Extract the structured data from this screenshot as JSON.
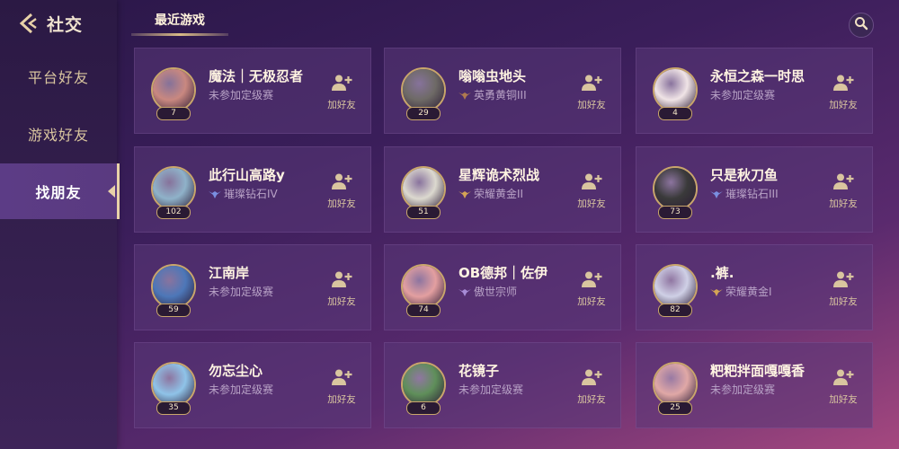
{
  "header": {
    "title": "社交",
    "tab": "最近游戏"
  },
  "sidebar": {
    "items": [
      {
        "label": "平台好友"
      },
      {
        "label": "游戏好友"
      },
      {
        "label": "找朋友"
      }
    ]
  },
  "colors": {
    "accent": "#d9bb86",
    "text_gold": "#d9c59f",
    "name": "#fff4e2",
    "rank_text": "#b9a3c7"
  },
  "friends": [
    {
      "name": "魔法｜无极忍者",
      "rank": "未参加定级赛",
      "level": "7",
      "rank_icon": "",
      "add_label": "加好友",
      "avatar_color": "#c98880"
    },
    {
      "name": "嗡嗡虫地头",
      "rank": "英勇黄铜III",
      "level": "29",
      "rank_icon": "bronze",
      "add_label": "加好友",
      "avatar_color": "#6e6a66"
    },
    {
      "name": "永恒之森一时思",
      "rank": "未参加定级赛",
      "level": "4",
      "rank_icon": "",
      "add_label": "加好友",
      "avatar_color": "#f0e4e6"
    },
    {
      "name": "此行山高路y",
      "rank": "璀璨钻石IV",
      "level": "102",
      "rank_icon": "diamond",
      "add_label": "加好友",
      "avatar_color": "#8fb2c9"
    },
    {
      "name": "星辉诡术烈战",
      "rank": "荣耀黄金II",
      "level": "51",
      "rank_icon": "gold",
      "add_label": "加好友",
      "avatar_color": "#dcd9cf"
    },
    {
      "name": "只是秋刀鱼",
      "rank": "璀璨钻石III",
      "level": "73",
      "rank_icon": "diamond",
      "add_label": "加好友",
      "avatar_color": "#3a3a3a"
    },
    {
      "name": "江南岸",
      "rank": "未参加定级赛",
      "level": "59",
      "rank_icon": "",
      "add_label": "加好友",
      "avatar_color": "#4d77b8"
    },
    {
      "name": "OB德邦｜佐伊",
      "rank": "傲世宗师",
      "level": "74",
      "rank_icon": "master",
      "add_label": "加好友",
      "avatar_color": "#e39fa0"
    },
    {
      "name": ".裤.",
      "rank": "荣耀黄金I",
      "level": "82",
      "rank_icon": "gold",
      "add_label": "加好友",
      "avatar_color": "#cfd0e6"
    },
    {
      "name": "勿忘尘心",
      "rank": "未参加定级赛",
      "level": "35",
      "rank_icon": "",
      "add_label": "加好友",
      "avatar_color": "#8fc3e8"
    },
    {
      "name": "花镜子",
      "rank": "未参加定级赛",
      "level": "6",
      "rank_icon": "",
      "add_label": "加好友",
      "avatar_color": "#5f8f5a"
    },
    {
      "name": "粑粑拌面嘎嘎香",
      "rank": "未参加定级赛",
      "level": "25",
      "rank_icon": "",
      "add_label": "加好友",
      "avatar_color": "#e0a8a6"
    }
  ]
}
